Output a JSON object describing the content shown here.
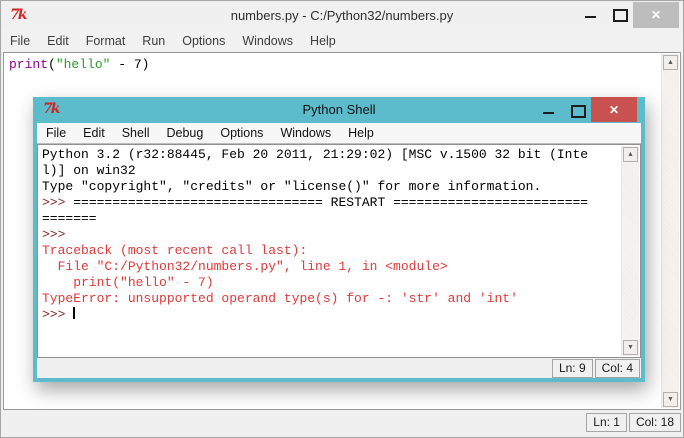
{
  "glyphs": {
    "tk_logo": "7k",
    "close": "✕",
    "up_arrow": "▲",
    "down_arrow": "▼"
  },
  "colors": {
    "active_titlebar_teal": "#5cbccb",
    "active_close_red": "#c9514f",
    "inactive_close_gray": "#bdbdbd",
    "prompt_maroon": "#7f2c2c",
    "stderr_red": "#dd3b3b",
    "keyword_purple": "#90008f",
    "string_green": "#28a028"
  },
  "editor_window": {
    "title": "numbers.py - C:/Python32/numbers.py",
    "menu": [
      "File",
      "Edit",
      "Format",
      "Run",
      "Options",
      "Windows",
      "Help"
    ],
    "code_lines": [
      {
        "segs": [
          [
            "keyword",
            "print"
          ],
          [
            "plain",
            "("
          ],
          [
            "string",
            "\"hello\""
          ],
          [
            "plain",
            " - 7)"
          ]
        ]
      }
    ],
    "status": {
      "ln": "Ln: 1",
      "col": "Col: 18"
    }
  },
  "shell_window": {
    "title": "Python Shell",
    "menu": [
      "File",
      "Edit",
      "Shell",
      "Debug",
      "Options",
      "Windows",
      "Help"
    ],
    "lines": [
      {
        "segs": [
          [
            "plain",
            "Python 3.2 (r32:88445, Feb 20 2011, 21:29:02) [MSC v.1500 32 bit (Inte"
          ]
        ]
      },
      {
        "segs": [
          [
            "plain",
            "l)] on win32"
          ]
        ]
      },
      {
        "segs": [
          [
            "plain",
            "Type \"copyright\", \"credits\" or \"license()\" for more information."
          ]
        ]
      },
      {
        "segs": [
          [
            "prompt",
            ">>> "
          ],
          [
            "plain",
            "================================ RESTART ========================="
          ]
        ]
      },
      {
        "segs": [
          [
            "plain",
            "======="
          ]
        ]
      },
      {
        "segs": [
          [
            "prompt",
            ">>>"
          ]
        ]
      },
      {
        "segs": [
          [
            "error",
            "Traceback (most recent call last):"
          ]
        ]
      },
      {
        "segs": [
          [
            "error",
            "  File \"C:/Python32/numbers.py\", line 1, in <module>"
          ]
        ]
      },
      {
        "segs": [
          [
            "error",
            "    print(\"hello\" - 7)"
          ]
        ]
      },
      {
        "segs": [
          [
            "error",
            "TypeError: unsupported operand type(s) for -: 'str' and 'int'"
          ]
        ]
      },
      {
        "segs": [
          [
            "prompt",
            ">>> "
          ]
        ],
        "cursor": true
      }
    ],
    "status": {
      "ln": "Ln: 9",
      "col": "Col: 4"
    }
  }
}
